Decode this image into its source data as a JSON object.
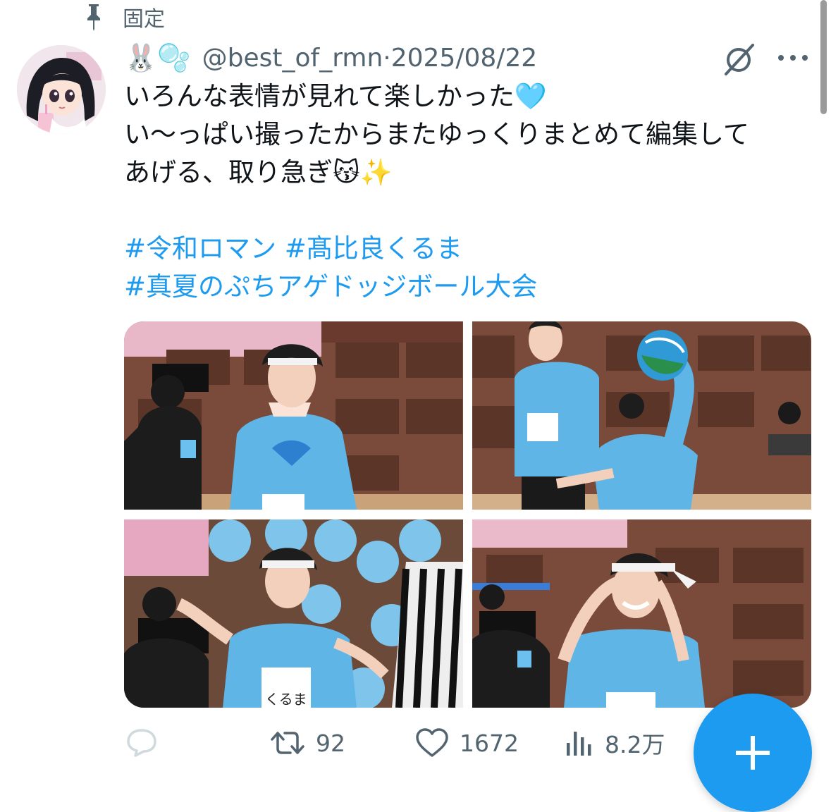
{
  "pinned": {
    "label": "固定"
  },
  "tweet": {
    "display_name_emoji": "🐰🫧",
    "handle": "@best_of_rmn",
    "separator": "·",
    "date": "2025/08/22",
    "text_lines": [
      "いろんな表情が見れて楽しかった🩵",
      "い〜っぱい撮ったからまたゆっくりまとめて編集して",
      "あげる、取り急ぎ😽✨"
    ],
    "hashtag_lines": [
      "#令和ロマン #髙比良くるま",
      "#真夏のぷちアゲドッジボール大会"
    ],
    "media": {
      "photos": [
        {
          "description": "player-with-headband-portrait"
        },
        {
          "description": "player-throwing-ball"
        },
        {
          "description": "player-pointing"
        },
        {
          "description": "player-laughing-adjusting-headband"
        }
      ],
      "bib_text": "くるま"
    }
  },
  "actions": {
    "reply_count": "",
    "retweet_count": "92",
    "like_count": "1672",
    "views_count": "8.2万"
  },
  "icons": {
    "pin": "pin-icon",
    "grok": "grok-icon",
    "more": "more-icon",
    "reply": "reply-icon",
    "retweet": "retweet-icon",
    "like": "heart-icon",
    "views": "views-icon",
    "compose": "plus-icon"
  },
  "colors": {
    "accent": "#1d9bf0",
    "muted": "#536471",
    "text": "#0f1419",
    "shirt": "#5fb6e6"
  }
}
